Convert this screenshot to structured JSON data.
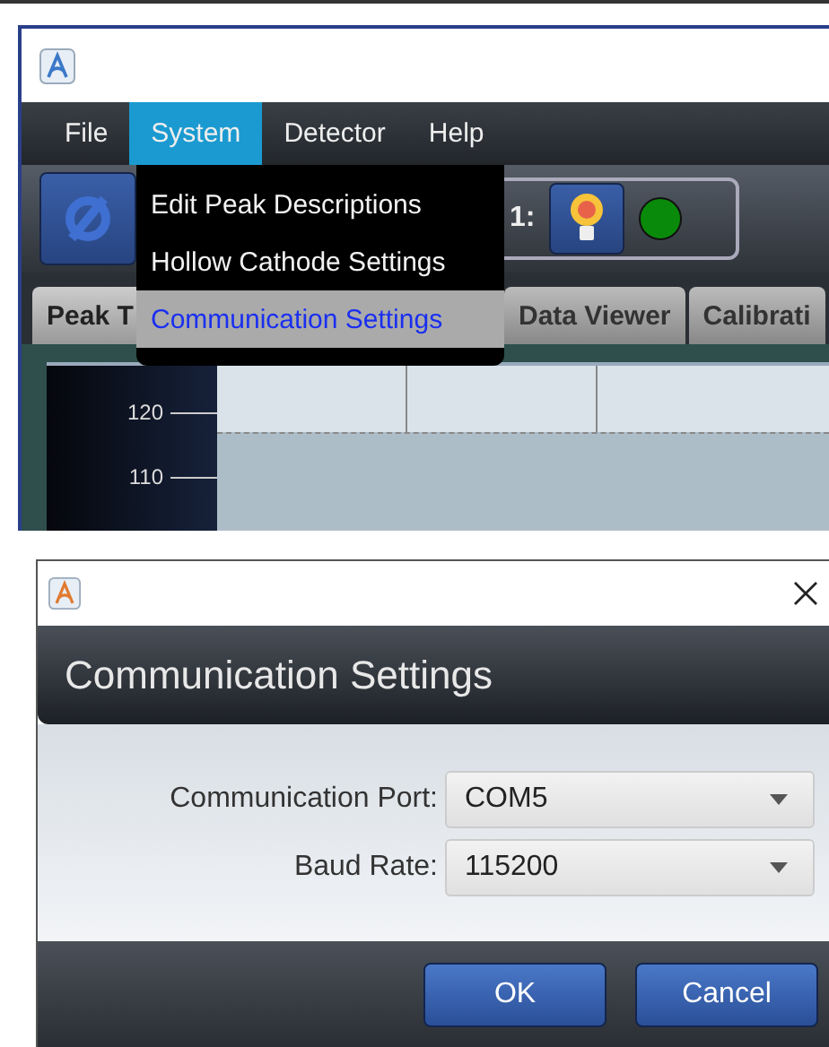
{
  "main_window": {
    "menu_bar": [
      {
        "label": "File",
        "selected": false
      },
      {
        "label": "System",
        "selected": true
      },
      {
        "label": "Detector",
        "selected": false
      },
      {
        "label": "Help",
        "selected": false
      }
    ],
    "system_menu": [
      {
        "label": "Edit Peak Descriptions",
        "selected": false
      },
      {
        "label": "Hollow Cathode Settings",
        "selected": false
      },
      {
        "label": "Communication Settings",
        "selected": true
      }
    ],
    "toolbar": {
      "channel_label": "1:",
      "status_on": true
    },
    "tabs": [
      {
        "label": "Peak T",
        "selected": true
      },
      {
        "label": "Data Viewer",
        "selected": false
      },
      {
        "label": "Calibrati",
        "selected": false
      }
    ],
    "plot": {
      "y_tick_labels": [
        "120",
        "110"
      ]
    }
  },
  "dialog": {
    "title": "Communication Settings",
    "fields": [
      {
        "label": "Communication Port:",
        "value": "COM5"
      },
      {
        "label": "Baud Rate:",
        "value": "115200"
      }
    ],
    "buttons": [
      "OK",
      "Cancel"
    ]
  }
}
